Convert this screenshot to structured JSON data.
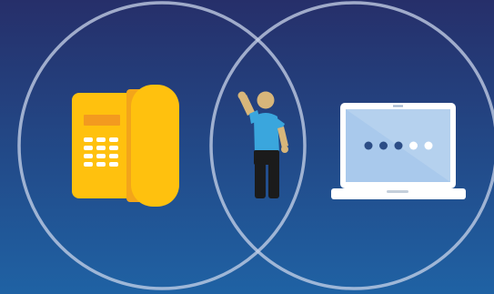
{
  "scene": {
    "colors": {
      "background_top": "#262f6a",
      "background_bottom": "#1f62a4",
      "circle_outline": "#c9d4ea",
      "phone_body": "#ffc10e",
      "phone_shadow": "#f3a51a",
      "phone_screen": "#f39a1f",
      "phone_keys": "#ffffff",
      "person_skin": "#d8b67a",
      "person_shirt": "#3aa6dd",
      "person_pants": "#1b1b1b",
      "laptop_frame": "#ffffff",
      "laptop_screen": "#a9c9ec",
      "laptop_dot_filled": "#2c4d86",
      "laptop_dot_empty": "#ffffff"
    },
    "icons": {
      "left_circle": "circle-outline",
      "right_circle": "circle-outline",
      "phone": "desk-phone-icon",
      "person": "waving-person-icon",
      "laptop": "laptop-password-icon"
    },
    "laptop_password_dots": {
      "filled": 3,
      "empty": 2
    }
  }
}
